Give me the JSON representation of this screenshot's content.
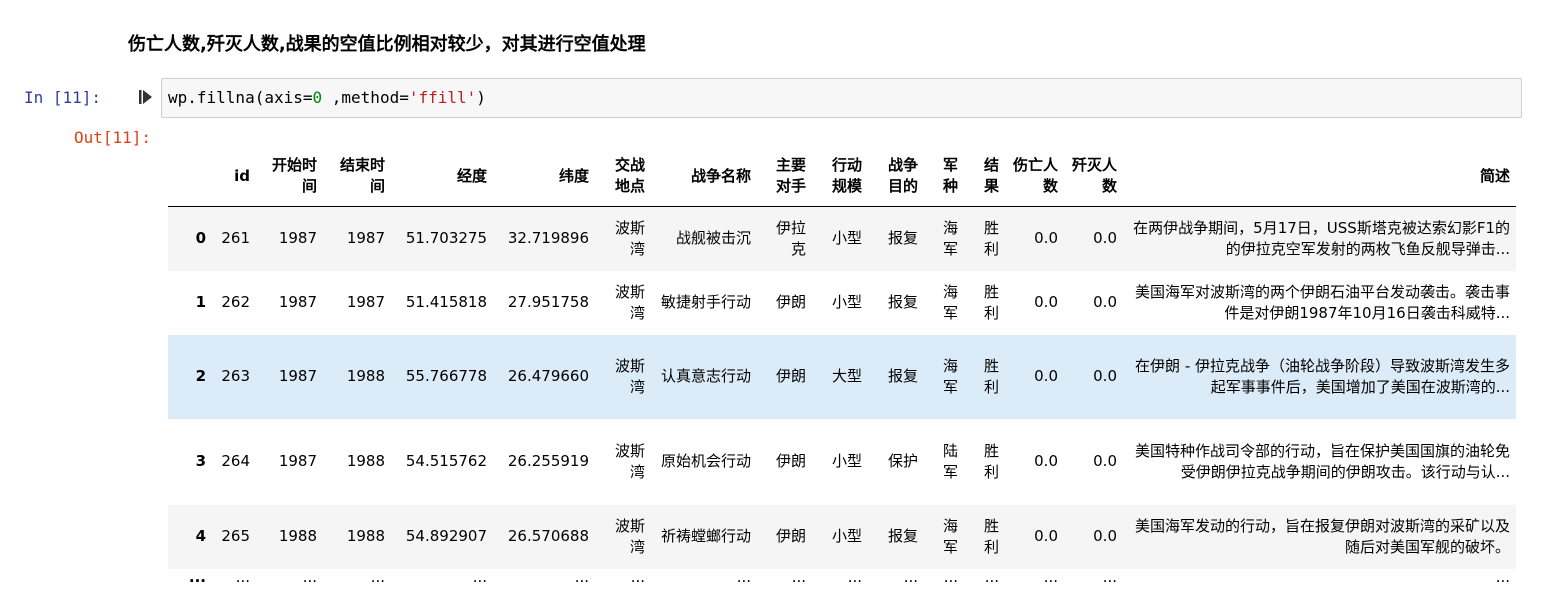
{
  "heading": "伤亡人数,歼灭人数,战果的空值比例相对较少，对其进行空值处理",
  "input_prompt": "In  [11]:",
  "output_prompt": "Out[11]:",
  "code": {
    "part1": "wp.fillna(axis=",
    "num": "0",
    "part2": " ,method=",
    "str": "'ffill'",
    "part3": ")"
  },
  "table": {
    "columns": [
      "",
      "id",
      "开始时间",
      "结束时间",
      "经度",
      "纬度",
      "交战地点",
      "战争名称",
      "主要对手",
      "行动规模",
      "战争目的",
      "军种",
      "结果",
      "伤亡人数",
      "歼灭人数",
      "简述"
    ],
    "rows": [
      [
        "0",
        "261",
        "1987",
        "1987",
        "51.703275",
        "32.719896",
        "波斯湾",
        "战舰被击沉",
        "伊拉克",
        "小型",
        "报复",
        "海军",
        "胜利",
        "0.0",
        "0.0",
        "在两伊战争期间，5月17日，USS斯塔克被达索幻影F1的的伊拉克空军发射的两枚飞鱼反舰导弹击..."
      ],
      [
        "1",
        "262",
        "1987",
        "1987",
        "51.415818",
        "27.951758",
        "波斯湾",
        "敏捷射手行动",
        "伊朗",
        "小型",
        "报复",
        "海军",
        "胜利",
        "0.0",
        "0.0",
        "美国海军对波斯湾的两个伊朗石油平台发动袭击。袭击事件是对伊朗1987年10月16日袭击科威特..."
      ],
      [
        "2",
        "263",
        "1987",
        "1988",
        "55.766778",
        "26.479660",
        "波斯湾",
        "认真意志行动",
        "伊朗",
        "大型",
        "报复",
        "海军",
        "胜利",
        "0.0",
        "0.0",
        "在伊朗 - 伊拉克战争（油轮战争阶段）导致波斯湾发生多起军事事件后，美国增加了美国在波斯湾的..."
      ],
      [
        "3",
        "264",
        "1987",
        "1988",
        "54.515762",
        "26.255919",
        "波斯湾",
        "原始机会行动",
        "伊朗",
        "小型",
        "保护",
        "陆军",
        "胜利",
        "0.0",
        "0.0",
        "美国特种作战司令部的行动，旨在保护美国国旗的油轮免受伊朗伊拉克战争期间的伊朗攻击。该行动与认..."
      ],
      [
        "4",
        "265",
        "1988",
        "1988",
        "54.892907",
        "26.570688",
        "波斯湾",
        "祈祷螳螂行动",
        "伊朗",
        "小型",
        "报复",
        "海军",
        "胜利",
        "0.0",
        "0.0",
        "美国海军发动的行动，旨在报复伊朗对波斯湾的采矿以及随后对美国军舰的破坏。"
      ],
      [
        "...",
        "...",
        "...",
        "...",
        "...",
        "...",
        "...",
        "...",
        "...",
        "...",
        "...",
        "...",
        "...",
        "...",
        "...",
        "..."
      ]
    ]
  }
}
